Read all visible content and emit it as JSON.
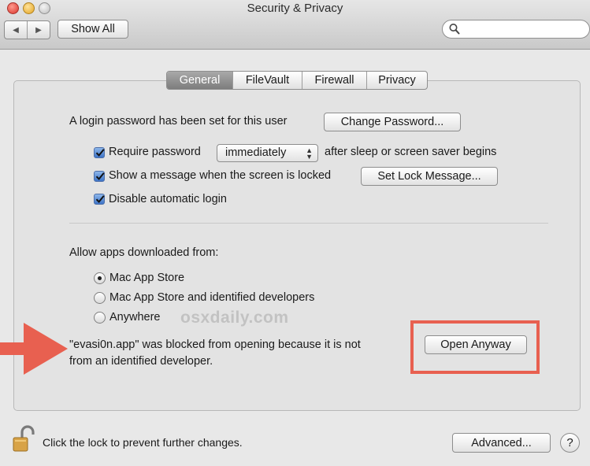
{
  "window": {
    "title": "Security & Privacy"
  },
  "toolbar": {
    "back_glyph": "◀",
    "forward_glyph": "▶",
    "show_all_label": "Show All",
    "search_value": ""
  },
  "tabs": [
    {
      "label": "General",
      "active": true
    },
    {
      "label": "FileVault",
      "active": false
    },
    {
      "label": "Firewall",
      "active": false
    },
    {
      "label": "Privacy",
      "active": false
    }
  ],
  "general": {
    "login_password_text": "A login password has been set for this user",
    "change_password_label": "Change Password...",
    "require_password": {
      "checked": true,
      "label": "Require password",
      "select_value": "immediately",
      "suffix": "after sleep or screen saver begins"
    },
    "show_message": {
      "checked": true,
      "label": "Show a message when the screen is locked",
      "button_label": "Set Lock Message..."
    },
    "disable_login": {
      "checked": true,
      "label": "Disable automatic login"
    },
    "allow_apps_label": "Allow apps downloaded from:",
    "radio_options": [
      {
        "label": "Mac App Store",
        "selected": true
      },
      {
        "label": "Mac App Store and identified developers",
        "selected": false
      },
      {
        "label": "Anywhere",
        "selected": false
      }
    ],
    "blocked_line1": "\"evasi0n.app\" was blocked from opening because it is not",
    "blocked_line2": "from an identified developer.",
    "open_anyway_label": "Open Anyway"
  },
  "watermark": "osxdaily.com",
  "footer": {
    "lock_text": "Click the lock to prevent further changes.",
    "advanced_label": "Advanced...",
    "help_label": "?"
  },
  "colors": {
    "annotation_red": "#e86050",
    "checkbox_blue": "#3e74c7"
  }
}
